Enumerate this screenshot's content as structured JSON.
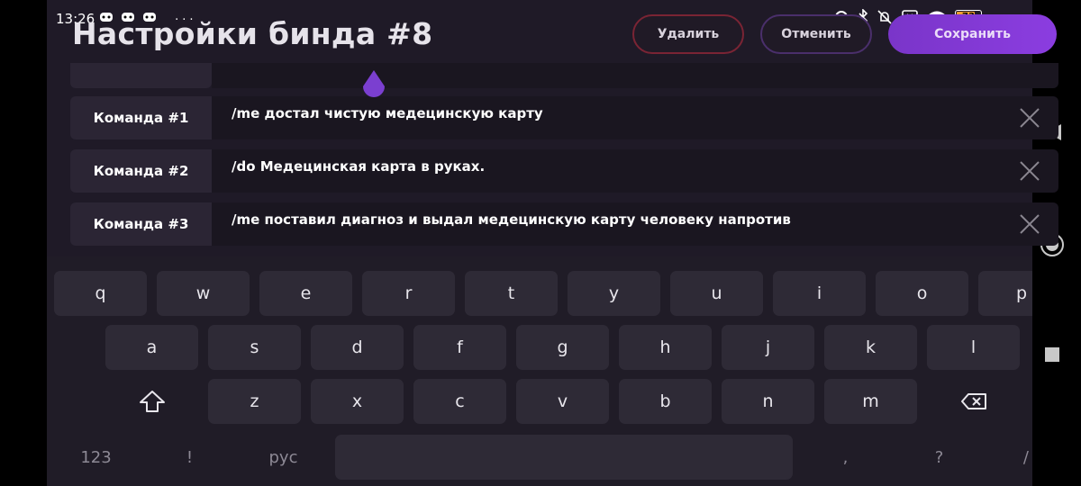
{
  "status_bar": {
    "time": "13:26",
    "left_icons": [
      "discord-icon",
      "discord-icon",
      "discord-icon"
    ],
    "more": "···",
    "battery_level": "73",
    "battery_color": "#f0a030"
  },
  "header": {
    "title": "Настройки бинда #8",
    "delete_label": "Удалить",
    "cancel_label": "Отменить",
    "save_label": "Сохранить",
    "accent_color": "#8b3de0",
    "delete_border": "#7a2434"
  },
  "commands": [
    {
      "label": "Команда #1",
      "value": "/me достал чистую медецинскую карту"
    },
    {
      "label": "Команда #2",
      "value": "/do Медецинская карта в руках."
    },
    {
      "label": "Команда #3",
      "value": "/me поставил диагноз и выдал медецинскую карту человеку напротив"
    }
  ],
  "keyboard": {
    "row1": [
      "q",
      "w",
      "e",
      "r",
      "t",
      "y",
      "u",
      "i",
      "o",
      "p"
    ],
    "row2": [
      "a",
      "s",
      "d",
      "f",
      "g",
      "h",
      "j",
      "k",
      "l"
    ],
    "row3": [
      "z",
      "x",
      "c",
      "v",
      "b",
      "n",
      "m"
    ],
    "bottom": {
      "numbers": "123",
      "exclaim": "!",
      "lang": "рус",
      "comma": ",",
      "question": "?",
      "slash": "/"
    }
  }
}
